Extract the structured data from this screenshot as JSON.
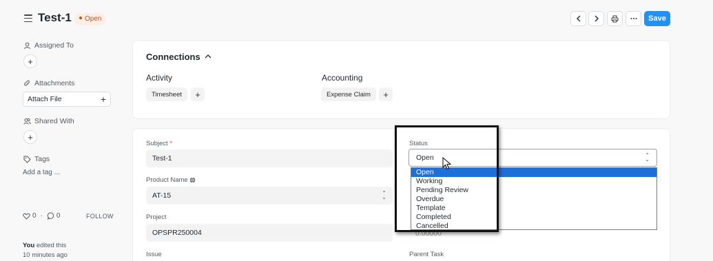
{
  "header": {
    "title": "Test-1",
    "status": "Open",
    "save_label": "Save",
    "prev_icon": "chevron-left-icon",
    "next_icon": "chevron-right-icon",
    "print_icon": "printer-icon",
    "more_icon": "ellipsis-icon"
  },
  "sidebar": {
    "assigned_to": "Assigned To",
    "attachments": "Attachments",
    "attach_file": "Attach File",
    "shared_with": "Shared With",
    "tags": "Tags",
    "add_tag": "Add a tag ...",
    "likes": "0",
    "comments": "0",
    "follow": "FOLLOW",
    "activity_user": "You",
    "activity_action": "edited this",
    "activity_time": "10 minutes ago"
  },
  "connections": {
    "title": "Connections",
    "groups": [
      {
        "title": "Activity",
        "items": [
          "Timesheet"
        ]
      },
      {
        "title": "Accounting",
        "items": [
          "Expense Claim"
        ]
      }
    ]
  },
  "form": {
    "subject_label": "Subject",
    "subject_value": "Test-1",
    "product_label": "Product Name",
    "product_value": "AT-15",
    "project_label": "Project",
    "project_value": "OPSPR250004",
    "issue_label": "Issue",
    "status_label": "Status",
    "status_value": "Open",
    "parent_task_label": "Parent Task",
    "hidden_value_fragment": "0.00000"
  },
  "status_options": [
    "Open",
    "Working",
    "Pending Review",
    "Overdue",
    "Template",
    "Completed",
    "Cancelled"
  ],
  "colors": {
    "primary": "#2490ef",
    "status_text": "#c24f18",
    "status_bg": "#fdeee6",
    "selected_option": "#1e6fd9"
  }
}
